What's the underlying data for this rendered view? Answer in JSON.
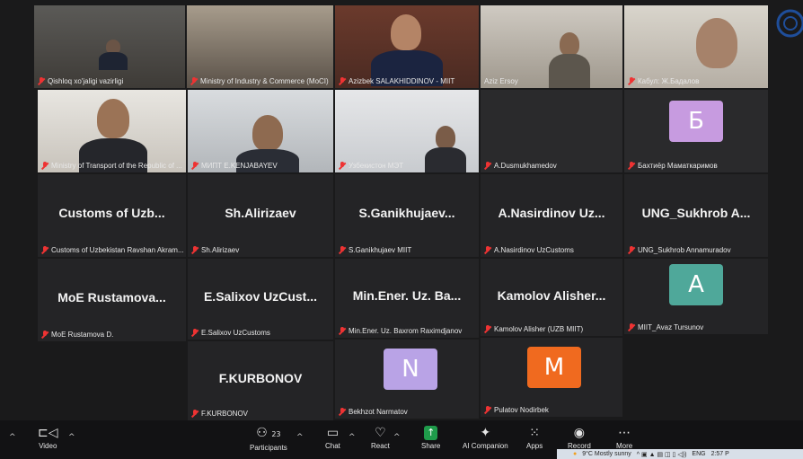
{
  "tiles": [
    {
      "name": "Qishloq xo'jaligi vazirligi"
    },
    {
      "name": "Ministry of Industry & Commerce (MoCI)"
    },
    {
      "name": "Azizbek SALAKHIDDINOV - MIIT"
    },
    {
      "name": "Aziz Ersoy"
    },
    {
      "name": "Кабул: Ж.Бадалов"
    },
    {
      "name": "Ministry of Transport of the Republic of ..."
    },
    {
      "name": "МИПТ E.KENJABAYEV"
    },
    {
      "name": "Узбекистон МЭТ"
    },
    {
      "name": "A.Dusmukhamedov"
    },
    {
      "name": "Бахтиёр Маматкаримов",
      "initial": "Б",
      "color": "#c79be0"
    },
    {
      "big": "Customs of Uzb...",
      "name": "Customs of Uzbekistan Ravshan Akram..."
    },
    {
      "big": "Sh.Alirizaev",
      "name": "Sh.Alirizaev"
    },
    {
      "big": "S.Ganikhujaev...",
      "name": "S.Ganikhujaev MIIT"
    },
    {
      "big": "A.Nasirdinov Uz...",
      "name": "A.Nasirdinov UzCustoms"
    },
    {
      "big": "UNG_Sukhrob A...",
      "name": "UNG_Sukhrob Annamuradov"
    },
    {
      "big": "MoE Rustamova...",
      "name": "MoE Rustamova D."
    },
    {
      "big": "E.Salixov UzCust...",
      "name": "E.Salixov UzCustoms"
    },
    {
      "big": "Min.Ener. Uz. Ba...",
      "name": "Min.Ener. Uz. Baxrom Raximdjanov"
    },
    {
      "big": "Kamolov Alisher...",
      "name": "Kamolov Alisher (UZB MIIT)"
    },
    {
      "name": "MIIT_Avaz Tursunov",
      "initial": "A",
      "color": "#4fa89a"
    },
    {
      "big": "F.KURBONOV",
      "name": "F.KURBONOV"
    },
    {
      "name": "Bekhzot Narmatov",
      "initial": "N",
      "color": "#b9a3e6"
    },
    {
      "name": "Pulatov Nodirbek",
      "initial": "M",
      "color": "#f06a1f"
    }
  ],
  "toolbar": {
    "video": "Video",
    "participants": "Participants",
    "participants_count": "23",
    "chat": "Chat",
    "react": "React",
    "share": "Share",
    "ai": "AI Companion",
    "apps": "Apps",
    "record": "Record",
    "more": "More"
  },
  "taskbar": {
    "weather": "9°C  Mostly sunny",
    "lang": "ENG",
    "time": "2:57 P"
  },
  "colors": {
    "share_green": "#1f9b4b",
    "mic_red": "#e33333",
    "brand_blue": "#1f4e9a"
  }
}
